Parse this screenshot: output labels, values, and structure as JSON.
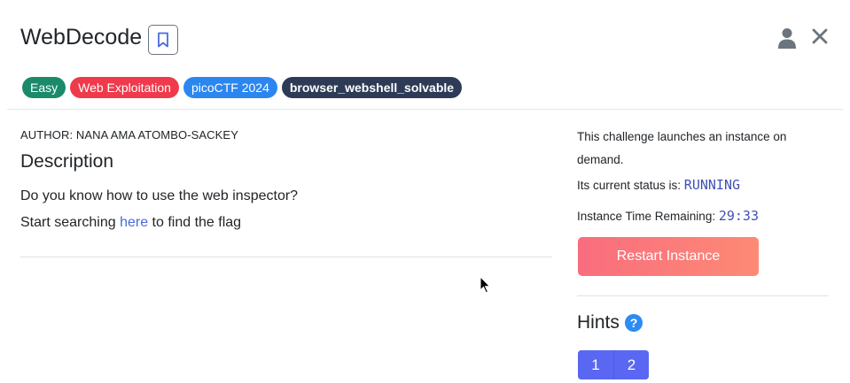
{
  "header": {
    "title": "WebDecode"
  },
  "tags": [
    {
      "label": "Easy",
      "color": "#1a8a6b"
    },
    {
      "label": "Web Exploitation",
      "color": "#ef3a4b"
    },
    {
      "label": "picoCTF 2024",
      "color": "#2b86f0"
    },
    {
      "label": "browser_webshell_solvable",
      "color": "#2d3b57"
    }
  ],
  "main": {
    "author": "AUTHOR: NANA AMA ATOMBO-SACKEY",
    "description_title": "Description",
    "line1": "Do you know how to use the web inspector?",
    "line2_prefix": "Start searching ",
    "line2_link": "here",
    "line2_suffix": " to find the flag"
  },
  "instance": {
    "launch_text": "This challenge launches an instance on demand.",
    "status_label": "Its current status is: ",
    "status_value": "RUNNING",
    "time_label": "Instance Time Remaining: ",
    "time_value": "29:33",
    "restart_label": "Restart Instance"
  },
  "hints": {
    "title": "Hints",
    "help_symbol": "?",
    "items": [
      "1",
      "2"
    ]
  },
  "icons": [
    "bookmark-icon",
    "user-icon",
    "close-icon",
    "help-icon"
  ]
}
